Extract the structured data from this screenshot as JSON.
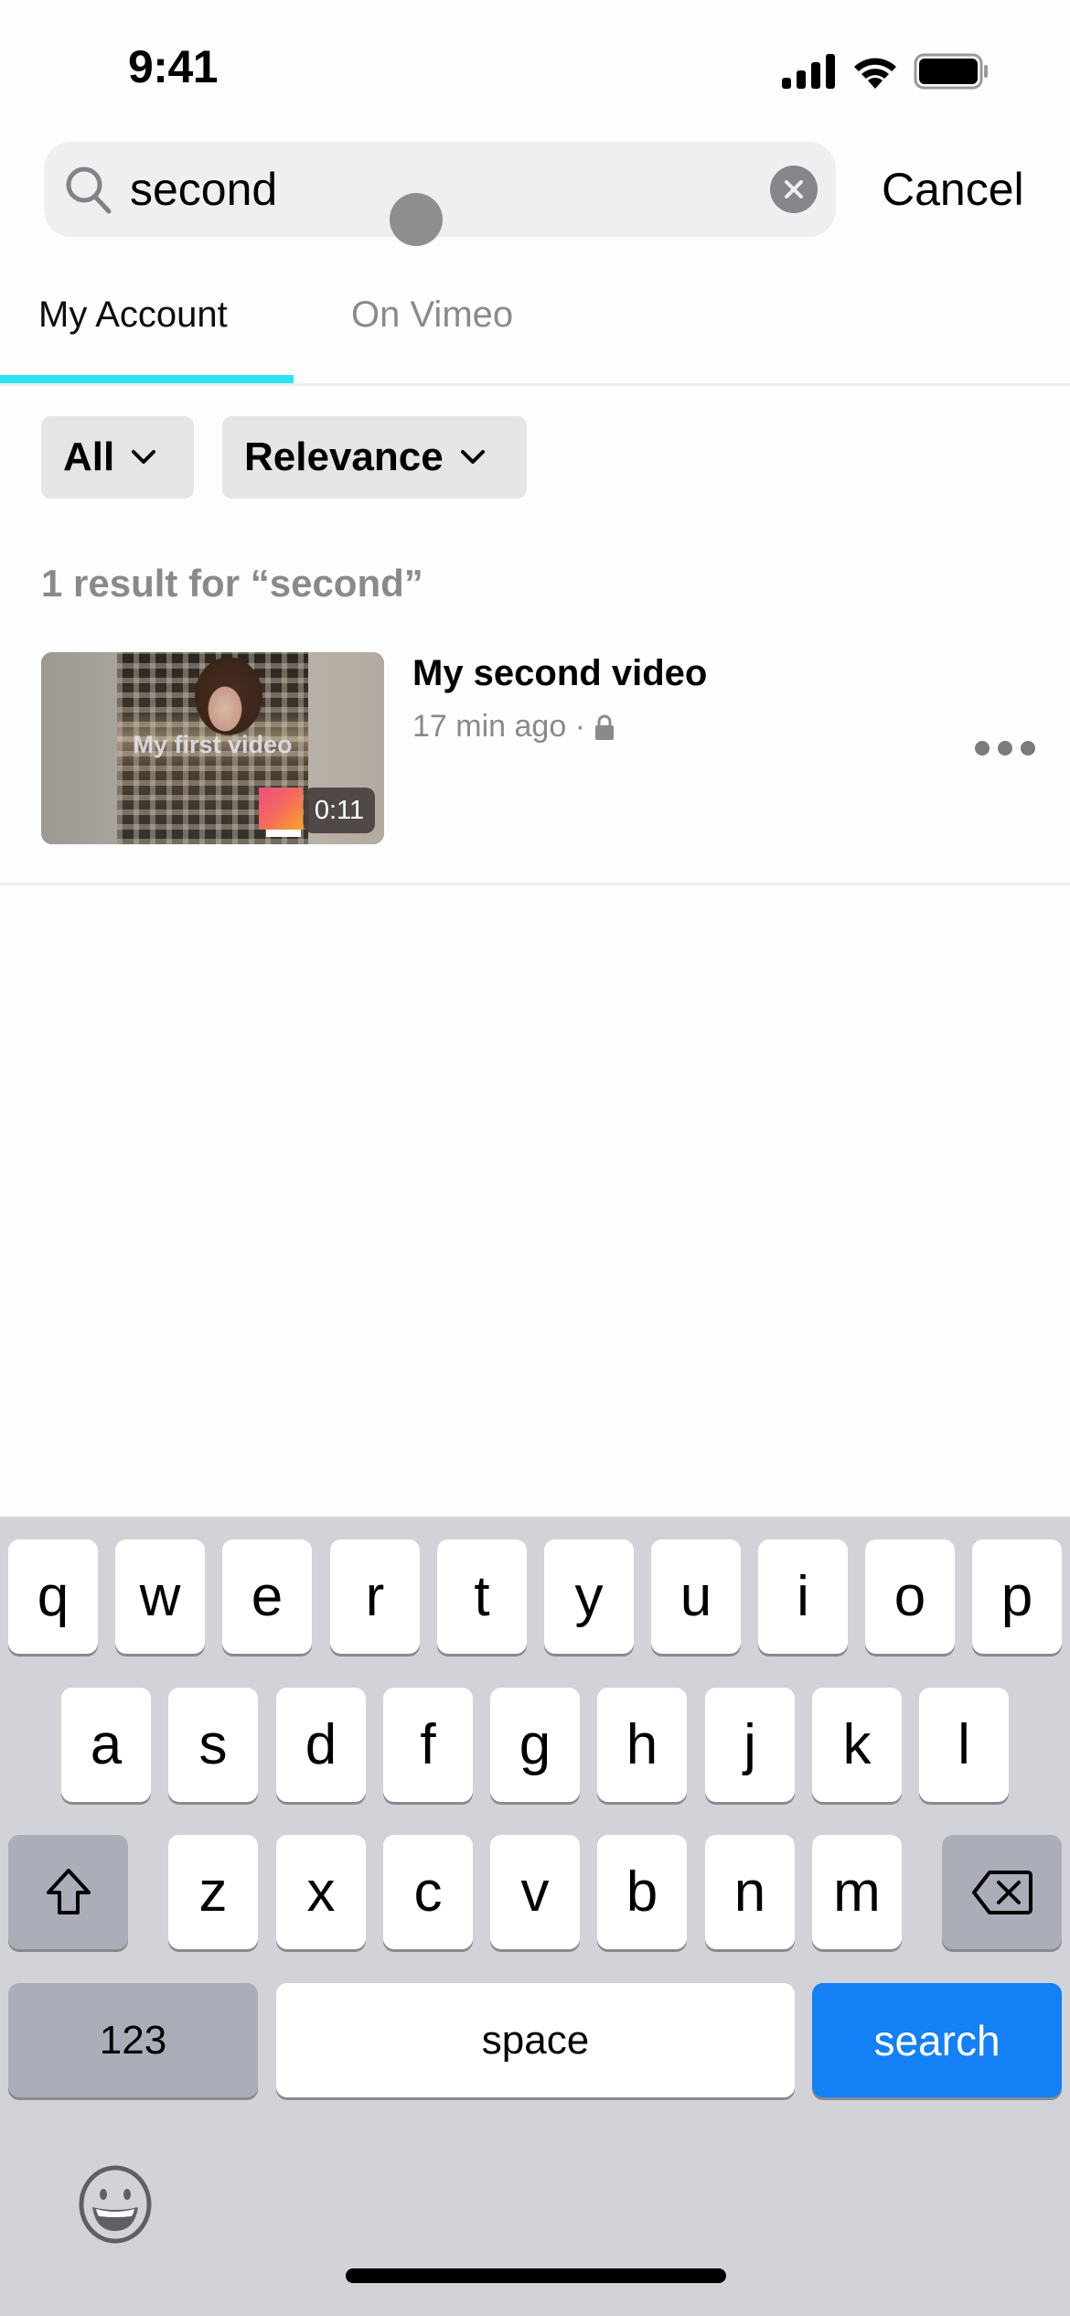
{
  "status_bar": {
    "time": "9:41",
    "icons": [
      "cellular-signal-icon",
      "wifi-icon",
      "battery-icon"
    ]
  },
  "search": {
    "value": "second",
    "placeholder": "",
    "cancel_label": "Cancel",
    "clear_icon": "clear-icon"
  },
  "tabs": [
    {
      "label": "My Account",
      "active": true
    },
    {
      "label": "On Vimeo",
      "active": false
    }
  ],
  "accent_color": "#2ee2f2",
  "filters": {
    "type": {
      "label": "All"
    },
    "sort": {
      "label": "Relevance"
    }
  },
  "results": {
    "summary": "1 result for “second”",
    "items": [
      {
        "title": "My second video",
        "meta": "17 min ago ·",
        "privacy_icon": "lock-icon",
        "duration": "0:11",
        "thumbnail_overlay_text": "My first video"
      }
    ]
  },
  "keyboard": {
    "row1": [
      "q",
      "w",
      "e",
      "r",
      "t",
      "y",
      "u",
      "i",
      "o",
      "p"
    ],
    "row2": [
      "a",
      "s",
      "d",
      "f",
      "g",
      "h",
      "j",
      "k",
      "l"
    ],
    "row3": [
      "z",
      "x",
      "c",
      "v",
      "b",
      "n",
      "m"
    ],
    "numbers_label": "123",
    "space_label": "space",
    "action_label": "search",
    "action_color": "#1380f5"
  }
}
